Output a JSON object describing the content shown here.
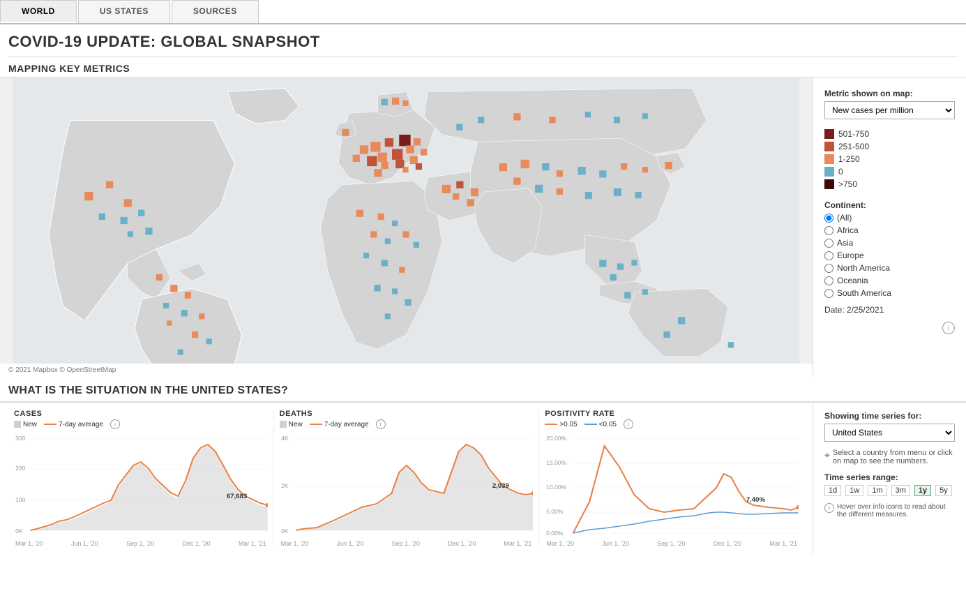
{
  "tabs": [
    {
      "label": "WORLD",
      "active": true
    },
    {
      "label": "US STATES",
      "active": false
    },
    {
      "label": "SOURCES",
      "active": false
    }
  ],
  "page_title": "COVID-19 UPDATE: GLOBAL SNAPSHOT",
  "map_section": {
    "title": "MAPPING KEY METRICS",
    "metric_label": "Metric shown on map:",
    "metric_value": "New cases per million",
    "legend": [
      {
        "color": "#7b1c1c",
        "label": "501-750"
      },
      {
        "color": "#c0533a",
        "label": "251-500"
      },
      {
        "color": "#e88a5a",
        "label": "1-250"
      },
      {
        "color": "#6ab0c8",
        "label": "0"
      },
      {
        "color": "#4a0f0f",
        "label": ">750"
      }
    ],
    "continent_label": "Continent:",
    "continents": [
      {
        "label": "(All)",
        "selected": true
      },
      {
        "label": "Africa",
        "selected": false
      },
      {
        "label": "Asia",
        "selected": false
      },
      {
        "label": "Europe",
        "selected": false
      },
      {
        "label": "North America",
        "selected": false
      },
      {
        "label": "Oceania",
        "selected": false
      },
      {
        "label": "South America",
        "selected": false
      }
    ],
    "date_label": "Date: 2/25/2021",
    "attribution": "© 2021 Mapbox © OpenStreetMap"
  },
  "situation_section": {
    "title": "WHAT IS THE SITUATION IN THE UNITED STATES?",
    "charts": [
      {
        "id": "cases",
        "title": "CASES",
        "legend": [
          {
            "type": "bar",
            "color": "#ccc",
            "label": "New"
          },
          {
            "type": "line",
            "color": "#e8834a",
            "label": "7-day average"
          }
        ],
        "y_labels": [
          "300",
          "200",
          "100",
          "0K"
        ],
        "x_labels": [
          "Mar 1, '20",
          "Jun 1, '20",
          "Sep 1, '20",
          "Dec 1, '20",
          "Mar 1, '21"
        ],
        "current_value": "67,683",
        "value_label_pos": {
          "bottom": "30%",
          "right": "25%"
        }
      },
      {
        "id": "deaths",
        "title": "DEATHS",
        "legend": [
          {
            "type": "bar",
            "color": "#ccc",
            "label": "New"
          },
          {
            "type": "line",
            "color": "#e8834a",
            "label": "7-day average"
          }
        ],
        "y_labels": [
          "4K",
          "2K",
          "0K"
        ],
        "x_labels": [
          "Mar 1, '20",
          "Jun 1, '20",
          "Sep 1, '20",
          "Dec 1, '20",
          "Mar 1, '21"
        ],
        "current_value": "2,039",
        "value_label_pos": {
          "bottom": "20%",
          "right": "12%"
        }
      },
      {
        "id": "positivity",
        "title": "POSITIVITY RATE",
        "legend": [
          {
            "type": "line",
            "color": "#e8834a",
            "label": ">0.05"
          },
          {
            "type": "line",
            "color": "#5b9bd5",
            "label": "<0.05"
          }
        ],
        "y_labels": [
          "20.00%",
          "15.00%",
          "10.00%",
          "5.00%",
          "0.00%"
        ],
        "x_labels": [
          "Mar 1, '20",
          "Jun 1, '20",
          "Sep 1, '20",
          "Dec 1, '20",
          "Mar 1, '21"
        ],
        "current_value": "7.40%",
        "value_label_pos": {
          "bottom": "35%",
          "right": "10%"
        }
      }
    ],
    "sidebar": {
      "showing_label": "Showing time series for:",
      "country_value": "United States",
      "select_hint": "Select a country from menu or click on map to see the numbers.",
      "time_range_label": "Time series range:",
      "time_buttons": [
        "1d",
        "1w",
        "1m",
        "3m",
        "1y",
        "5y"
      ],
      "active_time_btn": "1y",
      "hover_hint": "Hover over info icons to read about the different measures."
    }
  }
}
